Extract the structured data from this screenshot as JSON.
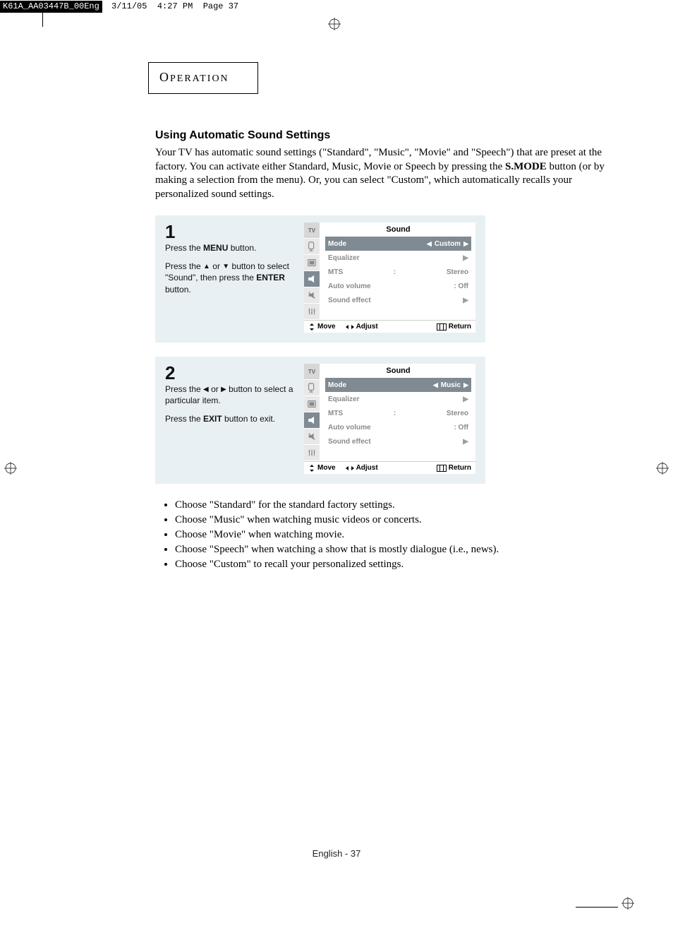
{
  "header_strip": {
    "filename": "K61A_AA03447B_00Eng",
    "date": "3/11/05",
    "time": "4:27 PM",
    "pagelabel": "Page 37"
  },
  "section_tab": "Operation",
  "heading": "Using Automatic Sound Settings",
  "intro": "Your TV has automatic sound settings (\"Standard\", \"Music\", \"Movie\" and \"Speech\")  that are preset at the factory.  You can activate either Standard, Music, Movie or Speech by pressing the S.MODE button (or by making a selection from the menu). Or, you can select \"Custom\", which automatically recalls your personalized sound settings.",
  "intro_parts": {
    "before_bold": "Your TV has automatic sound settings (\"Standard\", \"Music\", \"Movie\" and \"Speech\")  that are preset at the factory.  You can activate either Standard, Music, Movie or Speech by pressing the ",
    "bold": "S.MODE",
    "after_bold": " button (or by making a selection from the menu). Or, you can select \"Custom\", which automatically recalls your personalized sound settings."
  },
  "steps": [
    {
      "num": "1",
      "paragraphs_html": [
        "Press the <b>MENU</b> button.",
        "Press the <span class='triangle'>▲</span> or <span class='triangle'>▼</span> button to select \"Sound\", then press the <b>ENTER</b> button."
      ],
      "osd": {
        "title": "Sound",
        "tv_label": "TV",
        "active_tab_index": 2,
        "rows": [
          {
            "label": "Mode",
            "value": "Custom",
            "selected": true,
            "arrows_lr": true
          },
          {
            "label": "Equalizer",
            "value": "",
            "arrow_r": true
          },
          {
            "label": "MTS",
            "sep": ":",
            "value": "Stereo"
          },
          {
            "label": "Auto volume",
            "sep": "",
            "value": ": Off"
          },
          {
            "label": "Sound effect",
            "value": "",
            "arrow_r": true
          }
        ],
        "footer": {
          "move": "Move",
          "adjust": "Adjust",
          "return": "Return"
        }
      }
    },
    {
      "num": "2",
      "paragraphs_html": [
        "Press the <span class='triangle'>◀</span> or <span class='triangle'>▶</span> button to select a particular item.",
        "Press the <b>EXIT</b> button to exit."
      ],
      "osd": {
        "title": "Sound",
        "tv_label": "TV",
        "active_tab_index": 2,
        "rows": [
          {
            "label": "Mode",
            "value": "Music",
            "selected": true,
            "arrows_lr": true
          },
          {
            "label": "Equalizer",
            "value": "",
            "arrow_r": true
          },
          {
            "label": "MTS",
            "sep": ":",
            "value": "Stereo"
          },
          {
            "label": "Auto volume",
            "sep": "",
            "value": ": Off"
          },
          {
            "label": "Sound effect",
            "value": "",
            "arrow_r": true
          }
        ],
        "footer": {
          "move": "Move",
          "adjust": "Adjust",
          "return": "Return"
        }
      }
    }
  ],
  "bullets": [
    "Choose \"Standard\" for the standard factory settings.",
    "Choose \"Music\" when watching music videos or concerts.",
    "Choose \"Movie\" when watching movie.",
    "Choose \"Speech\" when watching a show that is mostly dialogue (i.e., news).",
    "Choose \"Custom\" to recall your personalized settings."
  ],
  "page_number": "English - 37"
}
